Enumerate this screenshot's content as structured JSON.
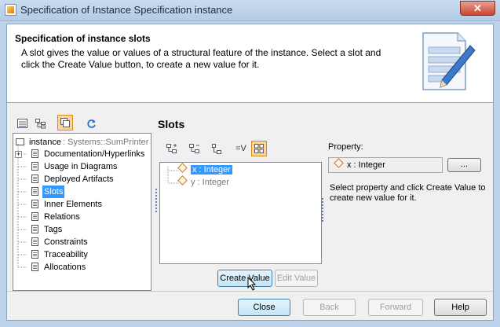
{
  "window": {
    "title": "Specification of Instance Specification instance",
    "close_glyph": "✕"
  },
  "header": {
    "title": "Specification of instance slots",
    "description": "A slot gives the value or values of a structural feature of the instance. Select a slot and click the Create Value button, to create a new value for it."
  },
  "tree": {
    "root_label": "instance",
    "root_type": " : Systems::SumPrinter",
    "items": [
      {
        "label": "Documentation/Hyperlinks"
      },
      {
        "label": "Usage in Diagrams"
      },
      {
        "label": "Deployed Artifacts"
      },
      {
        "label": "Slots"
      },
      {
        "label": "Inner Elements"
      },
      {
        "label": "Relations"
      },
      {
        "label": "Tags"
      },
      {
        "label": "Constraints"
      },
      {
        "label": "Traceability"
      },
      {
        "label": "Allocations"
      }
    ],
    "selected": "Slots"
  },
  "slots": {
    "title": "Slots",
    "toolbar_eq_label": "=V",
    "rows": [
      {
        "label": "x : Integer"
      },
      {
        "label": "y : Integer"
      }
    ],
    "create_value": "Create Value",
    "edit_value": "Edit Value"
  },
  "property": {
    "label": "Property:",
    "value": "x : Integer",
    "browse": "...",
    "help": "Select property and click Create Value to create new value for it."
  },
  "footer": {
    "close": "Close",
    "back": "Back",
    "forward": "Forward",
    "help": "Help"
  },
  "colors": {
    "selection": "#3399ff",
    "toolbar_selected": "#fbd59b",
    "window_frame": "#bcd3ea"
  },
  "icons": [
    "app-icon",
    "flat-list-icon",
    "tree-view-icon",
    "compact-view-icon",
    "refresh-icon",
    "diamond-slot-icon",
    "document-pencil-icon"
  ]
}
